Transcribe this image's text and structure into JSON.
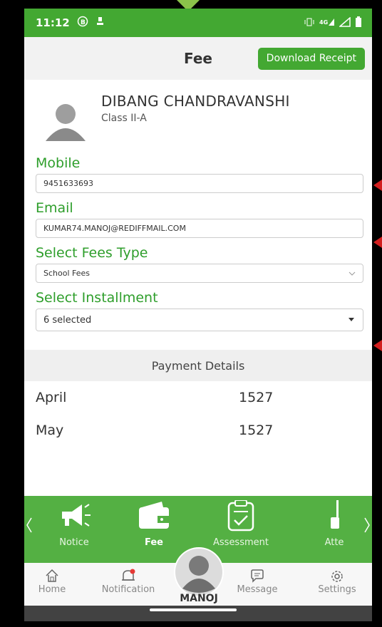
{
  "status_bar": {
    "time": "11:12"
  },
  "header": {
    "title": "Fee",
    "download_label": "Download Receipt"
  },
  "student": {
    "name": "DIBANG CHANDRAVANSHI",
    "class": "Class II-A"
  },
  "form": {
    "mobile_label": "Mobile",
    "mobile_value": "9451633693",
    "email_label": "Email",
    "email_value": "KUMAR74.MANOJ@REDIFFMAIL.COM",
    "fees_type_label": "Select Fees Type",
    "fees_type_value": "School Fees",
    "installment_label": "Select Installment",
    "installment_value": "6 selected"
  },
  "payment": {
    "title": "Payment Details",
    "rows": [
      {
        "month": "April",
        "amount": "1527"
      },
      {
        "month": "May",
        "amount": "1527"
      }
    ]
  },
  "green_nav": [
    {
      "label": "Notice",
      "icon": "megaphone-icon"
    },
    {
      "label": "Fee",
      "icon": "wallet-icon"
    },
    {
      "label": "Assessment",
      "icon": "clipboard-icon"
    },
    {
      "label": "Atte",
      "icon": "attendance-icon"
    }
  ],
  "bottom_nav": {
    "home": "Home",
    "notification": "Notification",
    "user": "MANOJ",
    "message": "Message",
    "settings": "Settings"
  },
  "colors": {
    "primary": "#43a832",
    "label": "#2e9e2b"
  }
}
